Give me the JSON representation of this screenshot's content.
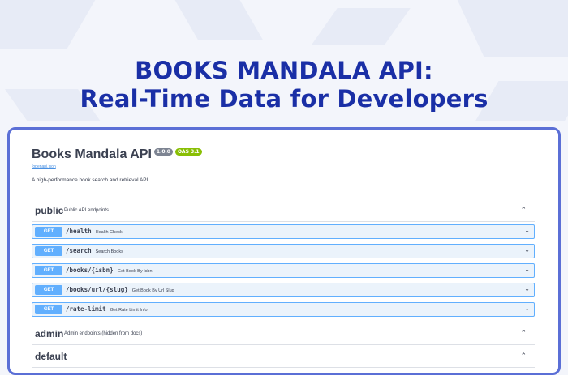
{
  "hero": {
    "line1": "BOOKS MANDALA API:",
    "line2": "Real-Time Data for Developers"
  },
  "api": {
    "title": "Books Mandala API",
    "version": "1.0.0",
    "oas": "OAS 3.1",
    "spec_link": "/openapi.json",
    "description": "A high-performance book search and retrieval API"
  },
  "sections": {
    "public": {
      "name": "public",
      "desc": "Public API endpoints"
    },
    "admin": {
      "name": "admin",
      "desc": "Admin endpoints (hidden from docs)"
    },
    "default": {
      "name": "default"
    }
  },
  "operations": [
    {
      "method": "GET",
      "path": "/health",
      "summary": "Health Check"
    },
    {
      "method": "GET",
      "path": "/search",
      "summary": "Search Books"
    },
    {
      "method": "GET",
      "path": "/books/{isbn}",
      "summary": "Get Book By Isbn"
    },
    {
      "method": "GET",
      "path": "/books/url/{slug}",
      "summary": "Get Book By Url Slug"
    },
    {
      "method": "GET",
      "path": "/rate-limit",
      "summary": "Get Rate Limit Info"
    }
  ],
  "colors": {
    "hero": "#1a2fa6",
    "get_method": "#61affe",
    "oas_badge": "#89bf04",
    "version_badge": "#7d8492"
  },
  "icons": {
    "section_toggle": "chevron-up-icon",
    "operation_toggle": "chevron-down-icon"
  }
}
